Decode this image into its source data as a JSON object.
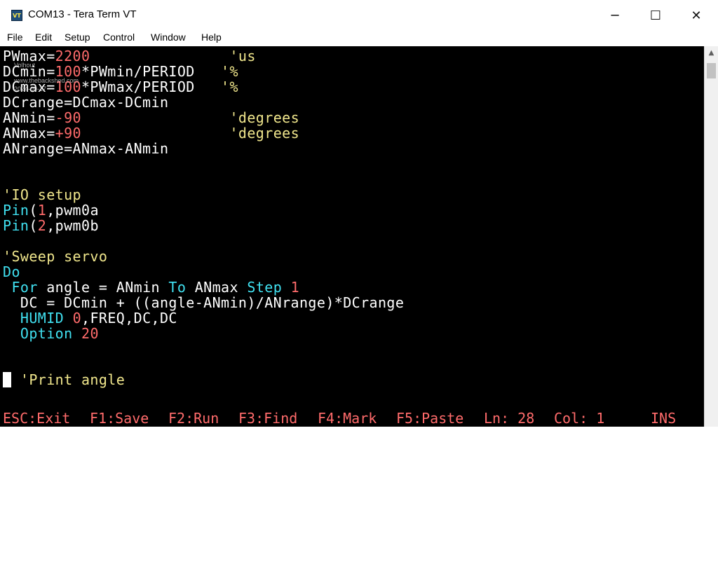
{
  "window": {
    "title": "COM13 - Tera Term VT",
    "icon": "teraterm-vt-icon",
    "icon_text": "VT",
    "minimize_glyph": "─",
    "maximize_glyph": "☐",
    "close_glyph": "✕"
  },
  "menu": {
    "items": [
      "File",
      "Edit",
      "Setup",
      "Control",
      "Window",
      "Help"
    ]
  },
  "colors": {
    "background": "#000000",
    "text": "#ffffff",
    "number": "#ff6b6b",
    "comment": "#f0e68c",
    "keyword": "#40e0f0"
  },
  "terminal": {
    "lines": [
      [
        {
          "t": "PWmax=",
          "c": "w"
        },
        {
          "t": "2200",
          "c": "r"
        },
        {
          "t": "                ",
          "c": "w"
        },
        {
          "t": "'us",
          "c": "y"
        }
      ],
      [
        {
          "t": "DCmin=",
          "c": "w"
        },
        {
          "t": "100",
          "c": "r"
        },
        {
          "t": "*PWmin/PERIOD   ",
          "c": "w"
        },
        {
          "t": "'%",
          "c": "y"
        }
      ],
      [
        {
          "t": "DCmax=",
          "c": "w"
        },
        {
          "t": "100",
          "c": "r"
        },
        {
          "t": "*PWmax/PERIOD   ",
          "c": "w"
        },
        {
          "t": "'%",
          "c": "y"
        }
      ],
      [
        {
          "t": "DCrange=DCmax-DCmin",
          "c": "w"
        }
      ],
      [
        {
          "t": "ANmin=",
          "c": "w"
        },
        {
          "t": "-90",
          "c": "r"
        },
        {
          "t": "                 ",
          "c": "w"
        },
        {
          "t": "'degrees",
          "c": "y"
        }
      ],
      [
        {
          "t": "ANmax=",
          "c": "w"
        },
        {
          "t": "+90",
          "c": "r"
        },
        {
          "t": "                 ",
          "c": "w"
        },
        {
          "t": "'degrees",
          "c": "y"
        }
      ],
      [
        {
          "t": "ANrange=ANmax-ANmin",
          "c": "w"
        }
      ],
      [],
      [],
      [
        {
          "t": "'IO setup",
          "c": "y"
        }
      ],
      [
        {
          "t": "Pin",
          "c": "c"
        },
        {
          "t": "(",
          "c": "w"
        },
        {
          "t": "1",
          "c": "r"
        },
        {
          "t": ",pwm0a",
          "c": "w"
        }
      ],
      [
        {
          "t": "Pin",
          "c": "c"
        },
        {
          "t": "(",
          "c": "w"
        },
        {
          "t": "2",
          "c": "r"
        },
        {
          "t": ",pwm0b",
          "c": "w"
        }
      ],
      [],
      [
        {
          "t": "'Sweep servo",
          "c": "y"
        }
      ],
      [
        {
          "t": "Do",
          "c": "c"
        }
      ],
      [
        {
          "t": " ",
          "c": "w"
        },
        {
          "t": "For",
          "c": "c"
        },
        {
          "t": " angle = ANmin ",
          "c": "w"
        },
        {
          "t": "To",
          "c": "c"
        },
        {
          "t": " ANmax ",
          "c": "w"
        },
        {
          "t": "Step",
          "c": "c"
        },
        {
          "t": " ",
          "c": "w"
        },
        {
          "t": "1",
          "c": "r"
        }
      ],
      [
        {
          "t": "  DC = DCmin + ((angle-ANmin)/ANrange)*DCrange",
          "c": "w"
        }
      ],
      [
        {
          "t": "  ",
          "c": "w"
        },
        {
          "t": "HUMID",
          "c": "c"
        },
        {
          "t": " ",
          "c": "w"
        },
        {
          "t": "0",
          "c": "r"
        },
        {
          "t": ",FREQ,DC,DC",
          "c": "w"
        }
      ],
      [
        {
          "t": "  ",
          "c": "w"
        },
        {
          "t": "Option",
          "c": "c"
        },
        {
          "t": " ",
          "c": "w"
        },
        {
          "t": "20",
          "c": "r"
        }
      ],
      [],
      [],
      [
        {
          "t": "  ",
          "c": "w"
        },
        {
          "t": "'Print angle",
          "c": "y"
        }
      ]
    ],
    "watermark": {
      "line1": "Volhout",
      "line2": "www.thebackshed.com",
      "line3": "2024-09-17"
    }
  },
  "status": {
    "items": [
      "ESC:Exit",
      "F1:Save",
      "F2:Run",
      "F3:Find",
      "F4:Mark",
      "F5:Paste",
      "Ln: 28",
      "Col: 1",
      "INS"
    ]
  },
  "scrollbar": {
    "up_glyph": "▲"
  }
}
